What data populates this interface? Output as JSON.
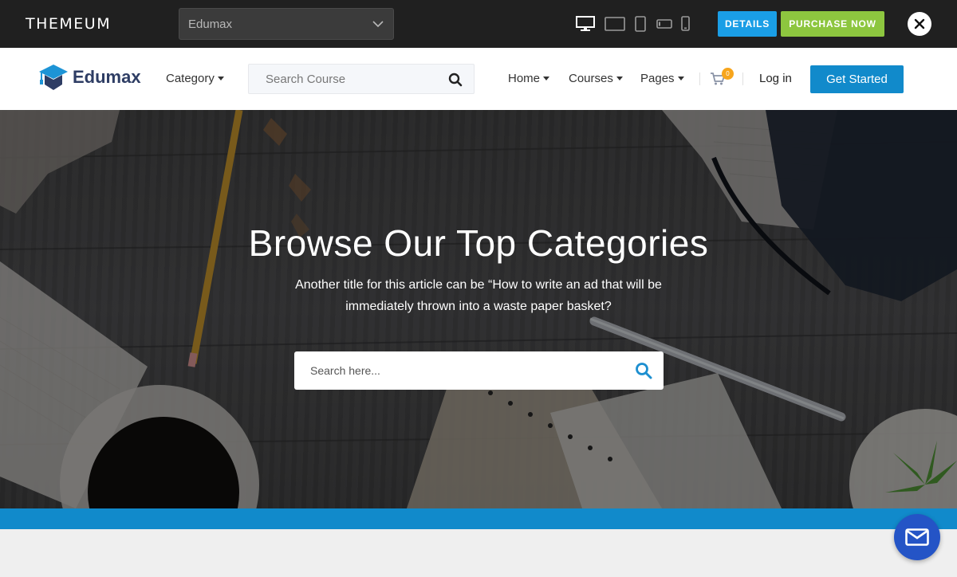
{
  "topbar": {
    "brand": "THEMEUM",
    "theme_select_value": "Edumax",
    "devices": [
      "desktop-icon",
      "tablet-landscape-icon",
      "tablet-portrait-icon",
      "phone-landscape-icon",
      "phone-portrait-icon"
    ],
    "details_label": "DETAILS",
    "purchase_label": "PURCHASE NOW",
    "close_icon": "close-icon"
  },
  "header": {
    "logo_text": "Edumax",
    "category_label": "Category",
    "search_placeholder": "Search Course",
    "nav": [
      "Home",
      "Courses",
      "Pages"
    ],
    "cart_count": "0",
    "login_label": "Log in",
    "cta_label": "Get Started"
  },
  "hero": {
    "title": "Browse Our Top Categories",
    "subtitle": "Another title for this article can be “How to write an ad that will be immediately thrown into a waste paper basket?",
    "search_placeholder": "Search here..."
  },
  "colors": {
    "topbar_bg": "#202020",
    "details": "#1a9ee6",
    "purchase": "#8dc63f",
    "primary": "#118acb",
    "logo": "#2e3d64",
    "badge": "#f7a51c",
    "chat": "#2454c6"
  }
}
